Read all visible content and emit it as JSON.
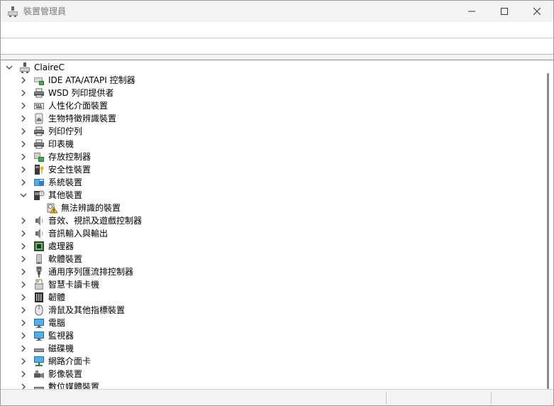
{
  "window": {
    "title": "裝置管理員"
  },
  "tree": {
    "root": {
      "label": "ClaireC",
      "icon": "computer-root-icon"
    },
    "items": [
      {
        "label": "IDE ATA/ATAPI 控制器",
        "icon": "ide-controller-icon",
        "expanded": false
      },
      {
        "label": "WSD 列印提供者",
        "icon": "printer-icon",
        "expanded": false
      },
      {
        "label": "人性化介面裝置",
        "icon": "hid-icon",
        "expanded": false
      },
      {
        "label": "生物特徵辨識裝置",
        "icon": "fingerprint-icon",
        "expanded": false
      },
      {
        "label": "列印佇列",
        "icon": "printer-icon",
        "expanded": false
      },
      {
        "label": "印表機",
        "icon": "printer-icon",
        "expanded": false
      },
      {
        "label": "存放控制器",
        "icon": "storage-controller-icon",
        "expanded": false
      },
      {
        "label": "安全性裝置",
        "icon": "security-key-icon",
        "expanded": false
      },
      {
        "label": "系統裝置",
        "icon": "system-device-icon",
        "expanded": false
      },
      {
        "label": "其他裝置",
        "icon": "other-device-icon",
        "expanded": true
      },
      {
        "label": "無法辨識的裝置",
        "icon": "unknown-device-warning-icon",
        "child": true
      },
      {
        "label": "音效、視訊及遊戲控制器",
        "icon": "speaker-icon",
        "expanded": false
      },
      {
        "label": "音訊輸入與輸出",
        "icon": "speaker-icon",
        "expanded": false
      },
      {
        "label": "處理器",
        "icon": "processor-icon",
        "expanded": false
      },
      {
        "label": "軟體裝置",
        "icon": "software-device-icon",
        "expanded": false
      },
      {
        "label": "通用序列匯流排控制器",
        "icon": "usb-icon",
        "expanded": false
      },
      {
        "label": "智慧卡讀卡機",
        "icon": "smartcard-reader-icon",
        "expanded": false
      },
      {
        "label": "韌體",
        "icon": "firmware-icon",
        "expanded": false
      },
      {
        "label": "滑鼠及其他指標裝置",
        "icon": "mouse-icon",
        "expanded": false
      },
      {
        "label": "電腦",
        "icon": "monitor-icon",
        "expanded": false
      },
      {
        "label": "監視器",
        "icon": "monitor-icon",
        "expanded": false
      },
      {
        "label": "磁碟機",
        "icon": "disk-drive-icon",
        "expanded": false
      },
      {
        "label": "網路介面卡",
        "icon": "network-adapter-icon",
        "expanded": false
      },
      {
        "label": "影像裝置",
        "icon": "camera-icon",
        "expanded": false
      },
      {
        "label": "數位媒體裝置",
        "icon": "disk-drive-icon",
        "expanded": false
      }
    ]
  }
}
